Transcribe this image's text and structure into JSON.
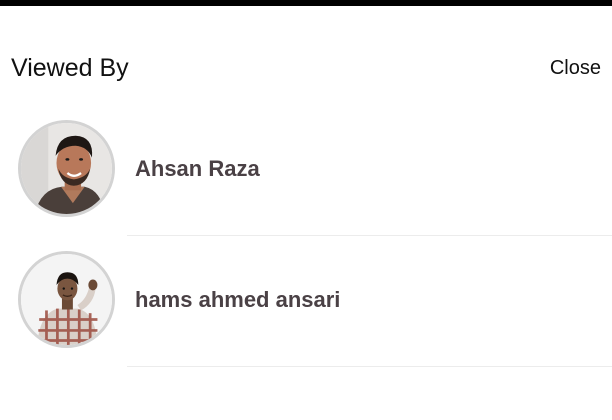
{
  "header": {
    "title": "Viewed By",
    "close_label": "Close"
  },
  "viewers": [
    {
      "name": "Ahsan Raza",
      "avatar_icon": "profile-photo"
    },
    {
      "name": "hams ahmed ansari",
      "avatar_icon": "profile-photo"
    }
  ],
  "colors": {
    "top_bar": "#000000",
    "name_text": "#4a4145",
    "avatar_border": "#d3d3d3",
    "divider": "#ececec"
  }
}
